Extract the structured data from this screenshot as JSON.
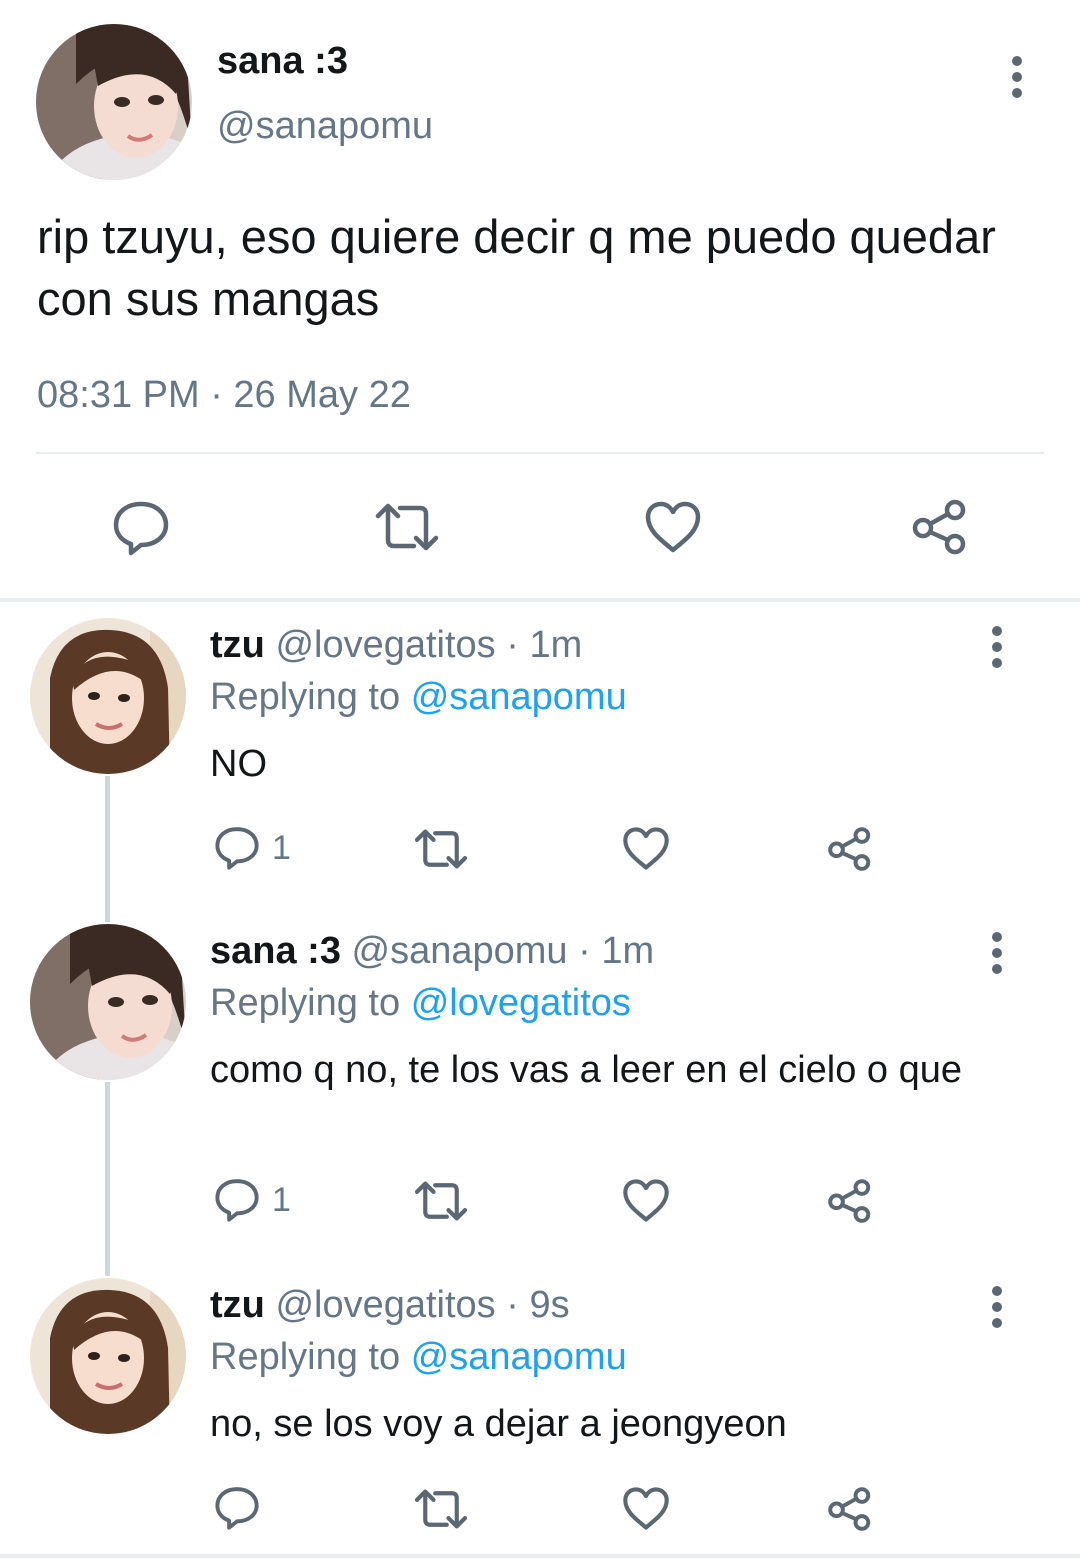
{
  "main_tweet": {
    "display_name": "sana :3",
    "handle": "@sanapomu",
    "text": "rip tzuyu, eso quiere decir q me puedo quedar con sus mangas",
    "timestamp": "08:31 PM · 26 May 22",
    "actions": {
      "reply_icon": "reply-bubble-icon",
      "retweet_icon": "retweet-icon",
      "like_icon": "heart-icon",
      "share_icon": "share-icon"
    }
  },
  "replies": [
    {
      "display_name": "tzu",
      "handle": "@lovegatitos",
      "separator": "·",
      "age": "1m",
      "replying_prefix": "Replying to",
      "replying_to": "@sanapomu",
      "text": "NO",
      "reply_count": "1"
    },
    {
      "display_name": "sana :3",
      "handle": "@sanapomu",
      "separator": "·",
      "age": "1m",
      "replying_prefix": "Replying to",
      "replying_to": "@lovegatitos",
      "text": "como q no, te los vas a leer en el cielo o que",
      "reply_count": "1"
    },
    {
      "display_name": "tzu",
      "handle": "@lovegatitos",
      "separator": "·",
      "age": "9s",
      "replying_prefix": "Replying to",
      "replying_to": "@sanapomu",
      "text": "no, se los voy a dejar a jeongyeon",
      "reply_count": ""
    }
  ],
  "colors": {
    "secondary_text": "#657786",
    "mention_blue": "#1da1f2",
    "icon_gray": "#5b6873",
    "thread_line": "#ccd6dd"
  }
}
